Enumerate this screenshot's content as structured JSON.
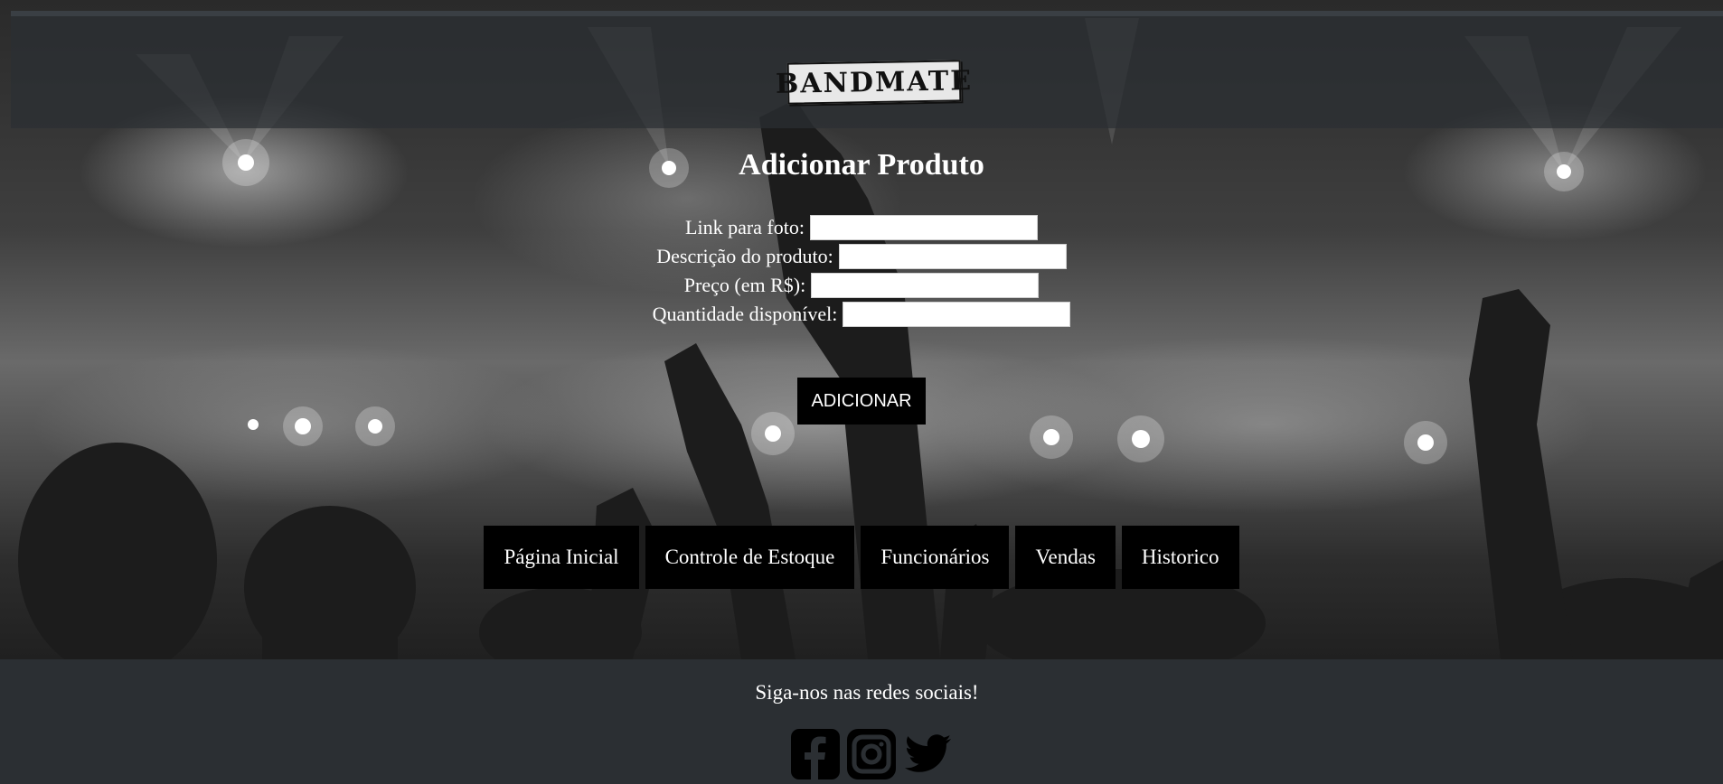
{
  "header": {
    "logo_text": "BANDMATE"
  },
  "form": {
    "title": "Adicionar Produto",
    "fields": [
      {
        "label": "Link para foto:",
        "value": ""
      },
      {
        "label": "Descrição do produto:",
        "value": ""
      },
      {
        "label": "Preço (em R$):",
        "value": ""
      },
      {
        "label": "Quantidade disponível:",
        "value": ""
      }
    ],
    "submit_label": "ADICIONAR"
  },
  "nav": {
    "items": [
      {
        "label": "Página Inicial"
      },
      {
        "label": "Controle de Estoque"
      },
      {
        "label": "Funcionários"
      },
      {
        "label": "Vendas"
      },
      {
        "label": "Historico"
      }
    ]
  },
  "footer": {
    "text": "Siga-nos nas redes sociais!",
    "social_icons": [
      "facebook-icon",
      "instagram-icon",
      "twitter-icon"
    ]
  },
  "colors": {
    "header_bg": "#2b2f33",
    "button_bg": "#000000",
    "text": "#ffffff"
  }
}
